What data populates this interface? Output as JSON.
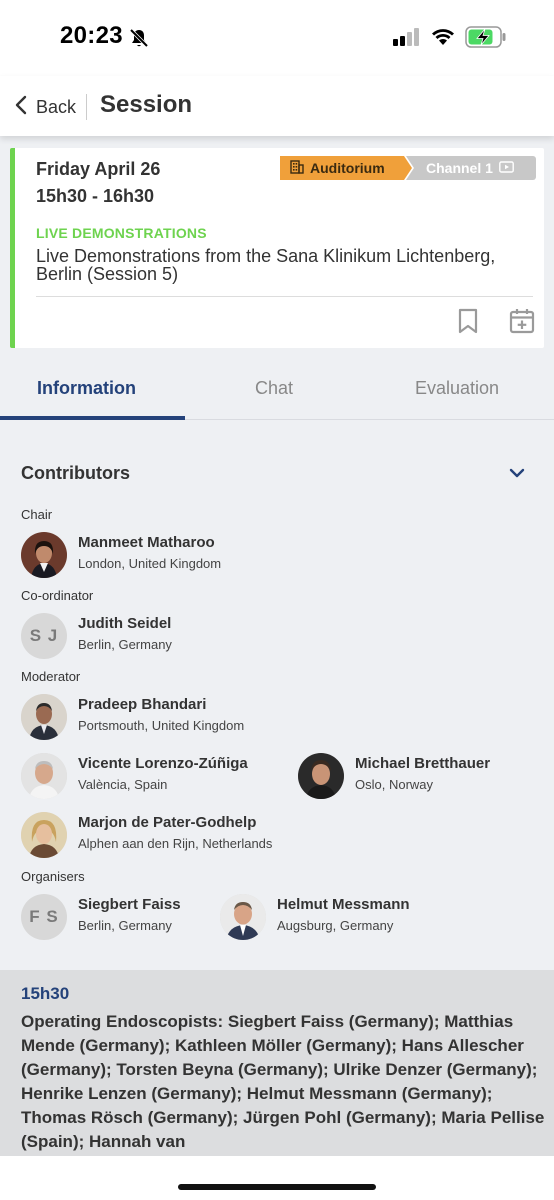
{
  "status_bar": {
    "time": "20:23"
  },
  "nav": {
    "back_label": "Back",
    "title": "Session"
  },
  "session": {
    "date": "Friday April 26",
    "time": "15h30 - 16h30",
    "room": "Auditorium",
    "channel": "Channel 1",
    "type": "LIVE DEMONSTRATIONS",
    "title": "Live Demonstrations from the Sana Klinikum Lichtenberg, Berlin (Session 5)",
    "accent_color": "#6ed34f",
    "room_color": "#f0a03a"
  },
  "tabs": [
    {
      "label": "Information",
      "active": true
    },
    {
      "label": "Chat",
      "active": false
    },
    {
      "label": "Evaluation",
      "active": false
    }
  ],
  "contributors": {
    "header": "Contributors",
    "roles": {
      "chair": "Chair",
      "coordinator": "Co-ordinator",
      "moderator": "Moderator",
      "organisers": "Organisers"
    },
    "people": {
      "chair": [
        {
          "name": "Manmeet Matharoo",
          "location": "London, United Kingdom",
          "avatar": "photo"
        }
      ],
      "coordinator": [
        {
          "name": "Judith Seidel",
          "location": "Berlin, Germany",
          "initials": "S J"
        }
      ],
      "moderator": [
        {
          "name": "Pradeep Bhandari",
          "location": "Portsmouth, United Kingdom",
          "avatar": "photo"
        },
        {
          "name": "Vicente Lorenzo-Zúñiga",
          "location": "València, Spain",
          "avatar": "photo"
        },
        {
          "name": "Michael Bretthauer",
          "location": "Oslo, Norway",
          "avatar": "photo"
        },
        {
          "name": "Marjon de Pater-Godhelp",
          "location": "Alphen aan den Rijn, Netherlands",
          "avatar": "photo"
        }
      ],
      "organisers": [
        {
          "name": "Siegbert Faiss",
          "location": "Berlin, Germany",
          "initials": "F S"
        },
        {
          "name": "Helmut Messmann",
          "location": "Augsburg, Germany",
          "avatar": "photo"
        }
      ]
    }
  },
  "program": {
    "time": "15h30",
    "text": "Operating Endoscopists: Siegbert Faiss (Germany); Matthias Mende (Germany); Kathleen Möller (Germany); Hans Allescher (Germany); Torsten Beyna (Germany); Ulrike Denzer (Germany); Henrike Lenzen (Germany); Helmut Messmann (Germany); Thomas Rösch (Germany); Jürgen Pohl (Germany); Maria Pellise (Spain); Hannah van"
  }
}
